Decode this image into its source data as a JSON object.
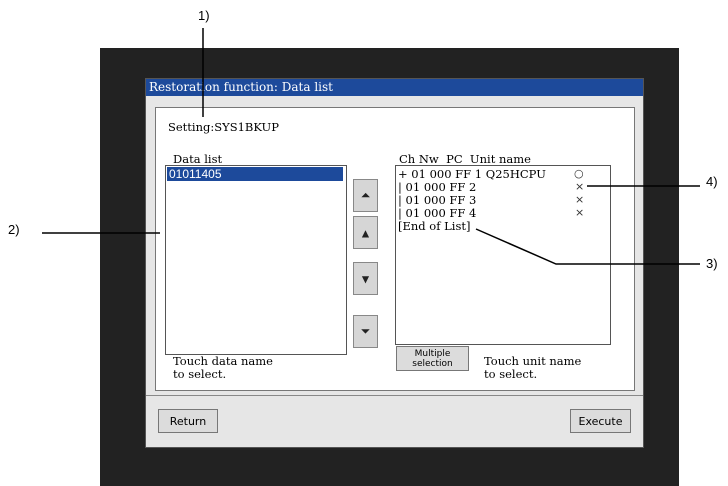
{
  "callouts": {
    "c1": "1)",
    "c2": "2)",
    "c3": "3)",
    "c4": "4)"
  },
  "window": {
    "title": "Restoration function: Data list",
    "setting": "Setting:SYS1BKUP",
    "data_list_header": "Data list",
    "data_items": [
      "01011405"
    ],
    "scroll_icons": [
      "double-up-arrow-icon",
      "up-arrow-icon",
      "down-arrow-icon",
      "double-down-arrow-icon"
    ],
    "unit_header": "Ch Nw  PC  Unit name",
    "unit_rows": [
      {
        "text": "+ 01 000 FF 1 Q25HCPU",
        "mark": "○"
      },
      {
        "text": "| 01 000 FF 2",
        "mark": "×"
      },
      {
        "text": "| 01 000 FF 3",
        "mark": "×"
      },
      {
        "text": "| 01 000 FF 4",
        "mark": "×"
      },
      {
        "text": "[End of List]",
        "mark": ""
      }
    ],
    "hint_left_1": "Touch data name",
    "hint_left_2": "to select.",
    "multiple_1": "Multiple",
    "multiple_2": "selection",
    "hint_right_1": "Touch unit name",
    "hint_right_2": "to select.",
    "return_label": "Return",
    "execute_label": "Execute"
  }
}
